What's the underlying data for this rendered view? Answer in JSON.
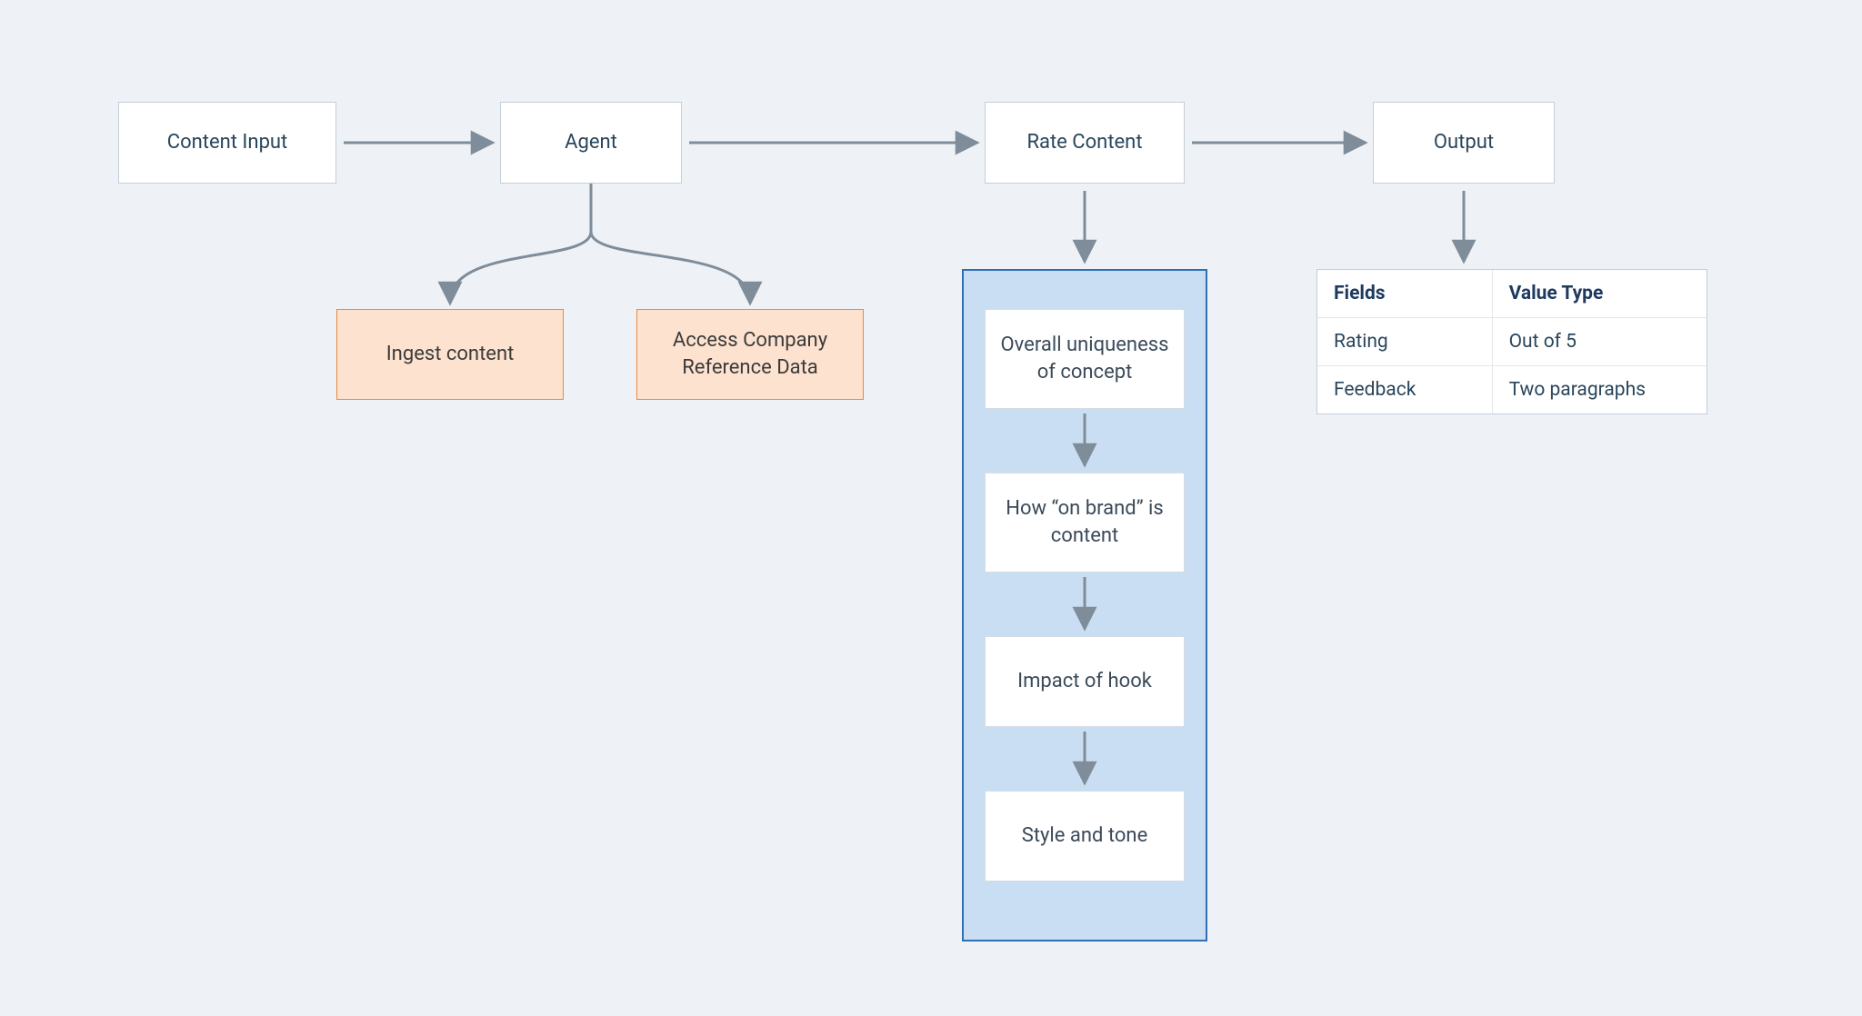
{
  "nodes": {
    "content_input": "Content Input",
    "agent": "Agent",
    "rate_content": "Rate Content",
    "output": "Output"
  },
  "agent_children": {
    "ingest": "Ingest content",
    "reference": "Access Company Reference Data"
  },
  "rating_steps": {
    "s1": "Overall uniqueness of concept",
    "s2": "How “on brand” is content",
    "s3": "Impact of hook",
    "s4": "Style and tone"
  },
  "output_table": {
    "header_fields": "Fields",
    "header_value": "Value Type",
    "row1_field": "Rating",
    "row1_value": "Out of 5",
    "row2_field": "Feedback",
    "row2_value": "Two paragraphs"
  }
}
